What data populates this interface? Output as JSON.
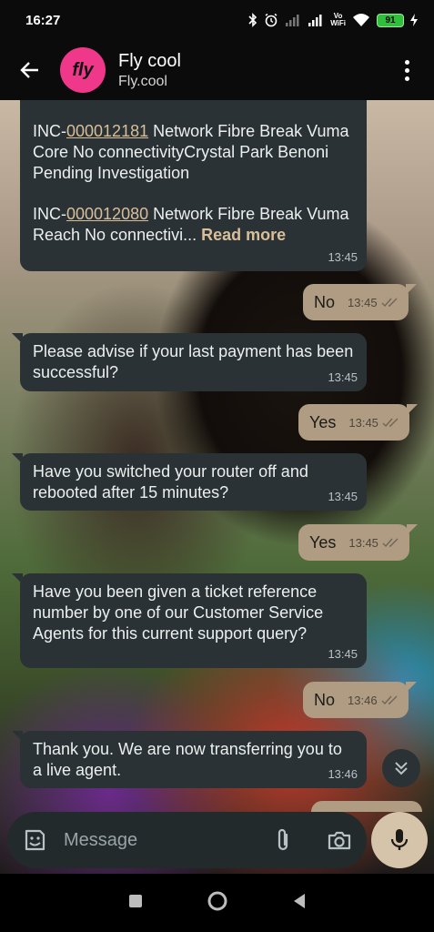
{
  "status_bar": {
    "time": "16:27",
    "volte": "Vo",
    "wifi_label": "WiFi",
    "battery": "91"
  },
  "header": {
    "avatar_text": "fly",
    "contact_name": "Fly cool",
    "contact_sub": "Fly.cool"
  },
  "messages": [
    {
      "type": "in",
      "lines": [
        {
          "prefix": "INC-",
          "link": "000012181",
          "rest": " Network  Fibre Break Vuma Core  No connectivityCrystal Park Benoni  Pending Investigation"
        },
        {
          "prefix": "INC-",
          "link": "000012080",
          "rest": " Network  Fibre Break Vuma Reach  No connectivi... "
        }
      ],
      "read_more": "Read more",
      "time": "13:45"
    },
    {
      "type": "out",
      "text": "No",
      "time": "13:45"
    },
    {
      "type": "in",
      "text": "Please advise if your last payment has been successful?",
      "time": "13:45"
    },
    {
      "type": "out",
      "text": "Yes",
      "time": "13:45"
    },
    {
      "type": "in",
      "text": "Have you switched your router off and rebooted after 15 minutes?",
      "time": "13:45"
    },
    {
      "type": "out",
      "text": "Yes",
      "time": "13:45"
    },
    {
      "type": "in",
      "text": "Have you been given a ticket reference number by one of our Customer Service Agents for this current support query?",
      "time": "13:45"
    },
    {
      "type": "out",
      "text": "No",
      "time": "13:46"
    },
    {
      "type": "in",
      "text": "Thank you. We are now transferring you to a live agent.",
      "time": "13:46"
    }
  ],
  "composer": {
    "placeholder": "Message"
  },
  "icons": {
    "back": "arrow-left-icon",
    "menu": "more-vertical-icon",
    "emoji": "sticker-icon",
    "attach": "paperclip-icon",
    "camera": "camera-icon",
    "mic": "mic-icon",
    "scroll": "chevron-double-down-icon"
  },
  "colors": {
    "incoming_bubble": "#2a3235",
    "outgoing_bubble": "#b09c82",
    "accent_link": "#d8bf9a",
    "avatar_bg": "#f0388a"
  }
}
